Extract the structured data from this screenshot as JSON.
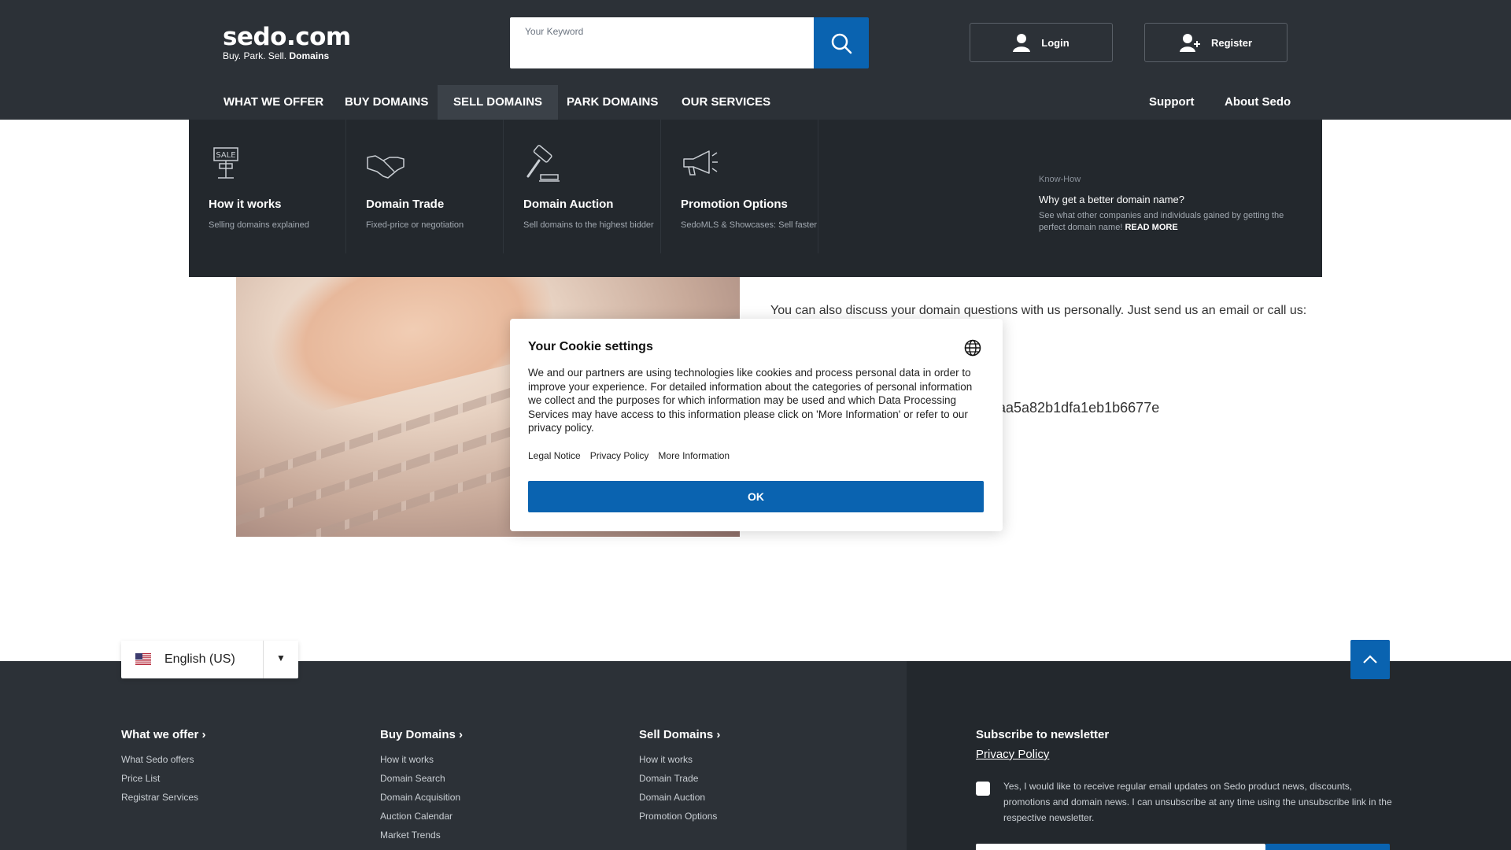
{
  "header": {
    "logo": {
      "main": "sedo.com",
      "tagline_plain": "Buy.  Park.  Sell. ",
      "tagline_bold": "Domains"
    },
    "search": {
      "label": "Your Keyword",
      "value": ""
    },
    "login_label": "Login",
    "register_label": "Register"
  },
  "nav": {
    "items": [
      "WHAT WE OFFER",
      "BUY DOMAINS",
      "SELL DOMAINS",
      "PARK DOMAINS",
      "OUR SERVICES"
    ],
    "active": "SELL DOMAINS",
    "right": [
      "Support",
      "About Sedo"
    ]
  },
  "dropdown": {
    "columns": [
      {
        "title": "How it works",
        "desc": "Selling domains explained",
        "icon": "sale-sign-icon",
        "icon_text": "SALE"
      },
      {
        "title": "Domain Trade",
        "desc": "Fixed-price or negotiation",
        "icon": "handshake-icon"
      },
      {
        "title": "Domain Auction",
        "desc": "Sell domains to the highest bidder",
        "icon": "gavel-icon"
      },
      {
        "title": "Promotion Options",
        "desc": "SedoMLS & Showcases: Sell faster",
        "icon": "megaphone-icon"
      }
    ],
    "knowhow": {
      "label": "Know-How",
      "title": "Why get a better domain name?",
      "text": "See what other companies and individuals gained by getting the perfect domain name!",
      "read_more": "READ MORE"
    }
  },
  "content": {
    "contact_text": "You can also discuss your domain questions with us personally. Just send us an email or call us:",
    "code_fragment": "aa5a82b1dfa1eb1b6677e"
  },
  "cookie": {
    "title": "Your Cookie settings",
    "body": "We and our partners are using technologies like cookies and process personal data in order to improve your experience. For detailed information about the categories of personal information we collect and the purposes for which information may be used and which Data Processing Services may have access to this information please click on 'More Information' or refer to our privacy policy.",
    "links": [
      "Legal Notice",
      "Privacy Policy",
      "More Information"
    ],
    "ok_label": "OK"
  },
  "language": {
    "label": "English (US)",
    "flag": "us-flag-icon"
  },
  "footer": {
    "columns": [
      {
        "heading": "What we offer",
        "links": [
          "What Sedo offers",
          "Price List",
          "Registrar Services"
        ]
      },
      {
        "heading": "Buy Domains",
        "links": [
          "How it works",
          "Domain Search",
          "Domain Acquisition",
          "Auction Calendar",
          "Market Trends"
        ]
      },
      {
        "heading": "Sell Domains",
        "links": [
          "How it works",
          "Domain Trade",
          "Domain Auction",
          "Promotion Options"
        ]
      }
    ],
    "newsletter": {
      "heading": "Subscribe to newsletter",
      "privacy": "Privacy Policy",
      "consent": "Yes, I would like to receive regular email updates on Sedo product news, discounts, promotions and domain news. I can unsubscribe at any time using the unsubscribe link in the respective newsletter."
    }
  },
  "colors": {
    "header_bg": "#2c3137",
    "dropdown_bg": "#23282d",
    "accent": "#0a63b0"
  }
}
